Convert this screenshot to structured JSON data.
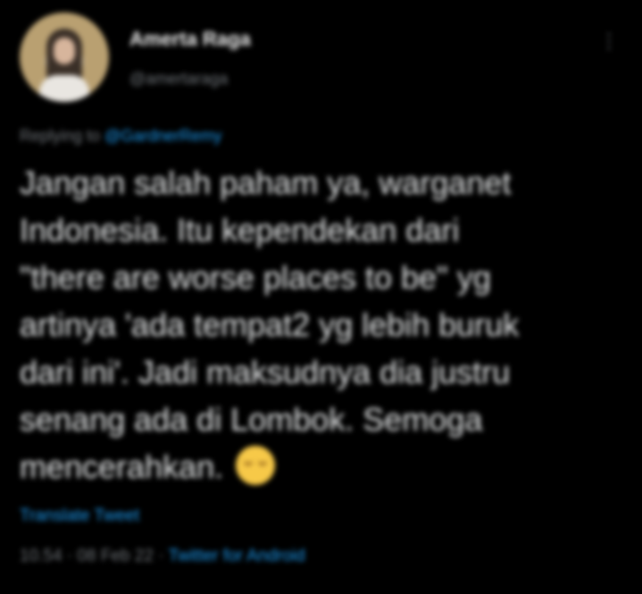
{
  "tweet": {
    "display_name": "Amerta Raga",
    "handle": "@amertaraga",
    "more_icon": "more-icon",
    "reply_prefix": "Replying to",
    "reply_to": "@GardnerRemy",
    "text": "Jangan salah paham ya, warganet\nIndonesia. Itu kependekan dari\n\"there are worse places to be\" yg\nartinya 'ada tempat2 yg lebih buruk\ndari ini'. Jadi maksudnya dia justru\nsenang ada di Lombok. Semoga\nmencerahkan.",
    "emoji": "smiling-face-emoji",
    "translate_label": "Translate Tweet",
    "timestamp": "10.54 · 08 Feb 22 ·",
    "source": "Twitter for Android"
  },
  "colors": {
    "background": "#000000",
    "text": "#e7e9ea",
    "secondary": "#71767b",
    "accent": "#1d9bf0"
  }
}
